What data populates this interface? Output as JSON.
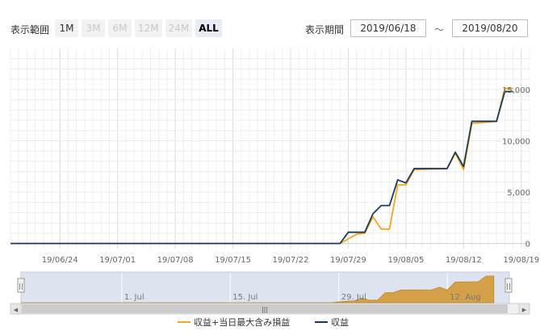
{
  "toolbar": {
    "range_label": "表示範囲",
    "range_buttons": [
      {
        "label": "1M",
        "enabled": true,
        "active": false
      },
      {
        "label": "3M",
        "enabled": false,
        "active": false
      },
      {
        "label": "6M",
        "enabled": false,
        "active": false
      },
      {
        "label": "12M",
        "enabled": false,
        "active": false
      },
      {
        "label": "24M",
        "enabled": false,
        "active": false
      },
      {
        "label": "ALL",
        "enabled": true,
        "active": true
      }
    ],
    "period_label": "表示期間",
    "date_from": "2019/06/18",
    "tilde": "～",
    "date_to": "2019/08/20"
  },
  "colors": {
    "series_orange": "#f5a623",
    "series_navy": "#1b3a5c",
    "navigator_fill": "#d4a14a",
    "navigator_bg": "#dde4f0"
  },
  "chart_data": {
    "type": "line",
    "x_start": "2019/06/18",
    "x_end": "2019/08/20",
    "x_tick_labels": [
      "19/06/24",
      "19/07/01",
      "19/07/08",
      "19/07/15",
      "19/07/22",
      "19/07/29",
      "19/08/05",
      "19/08/12",
      "19/08/19"
    ],
    "y_tick_labels": [
      "0",
      "5,000",
      "10,000",
      "15,000"
    ],
    "ylim": [
      -500,
      19000
    ],
    "grid": true,
    "legend_position": "bottom",
    "series": [
      {
        "name": "収益+当日最大含み損益",
        "color": "#f5a623",
        "points": [
          [
            "2019/06/18",
            0
          ],
          [
            "2019/07/28",
            0
          ],
          [
            "2019/07/30",
            900
          ],
          [
            "2019/07/31",
            1000
          ],
          [
            "2019/08/01",
            2600
          ],
          [
            "2019/08/02",
            1400
          ],
          [
            "2019/08/03",
            1400
          ],
          [
            "2019/08/04",
            5700
          ],
          [
            "2019/08/05",
            5700
          ],
          [
            "2019/08/06",
            7200
          ],
          [
            "2019/08/10",
            7300
          ],
          [
            "2019/08/11",
            8800
          ],
          [
            "2019/08/12",
            7200
          ],
          [
            "2019/08/13",
            11700
          ],
          [
            "2019/08/16",
            11900
          ],
          [
            "2019/08/17",
            15100
          ],
          [
            "2019/08/18",
            15100
          ]
        ]
      },
      {
        "name": "収益",
        "color": "#1b3a5c",
        "points": [
          [
            "2019/06/18",
            0
          ],
          [
            "2019/07/28",
            0
          ],
          [
            "2019/07/29",
            1100
          ],
          [
            "2019/07/31",
            1100
          ],
          [
            "2019/08/01",
            2900
          ],
          [
            "2019/08/02",
            3700
          ],
          [
            "2019/08/03",
            3700
          ],
          [
            "2019/08/04",
            6200
          ],
          [
            "2019/08/05",
            5900
          ],
          [
            "2019/08/06",
            7300
          ],
          [
            "2019/08/10",
            7300
          ],
          [
            "2019/08/11",
            8900
          ],
          [
            "2019/08/12",
            7500
          ],
          [
            "2019/08/13",
            11900
          ],
          [
            "2019/08/16",
            11900
          ],
          [
            "2019/08/17",
            14800
          ],
          [
            "2019/08/18",
            14800
          ]
        ]
      }
    ]
  },
  "navigator": {
    "labels": [
      {
        "text": "1. Jul",
        "date": "2019/07/01"
      },
      {
        "text": "15. Jul",
        "date": "2019/07/15"
      },
      {
        "text": "29. Jul",
        "date": "2019/07/29"
      },
      {
        "text": "12. Aug",
        "date": "2019/08/12"
      }
    ],
    "handle_glyph": "||",
    "thumb_glyph": "|||",
    "left_arrow": "◀",
    "right_arrow": "▶"
  },
  "legend": [
    {
      "label": "収益+当日最大含み損益",
      "color": "#f5a623"
    },
    {
      "label": "収益",
      "color": "#1b3a5c"
    }
  ]
}
